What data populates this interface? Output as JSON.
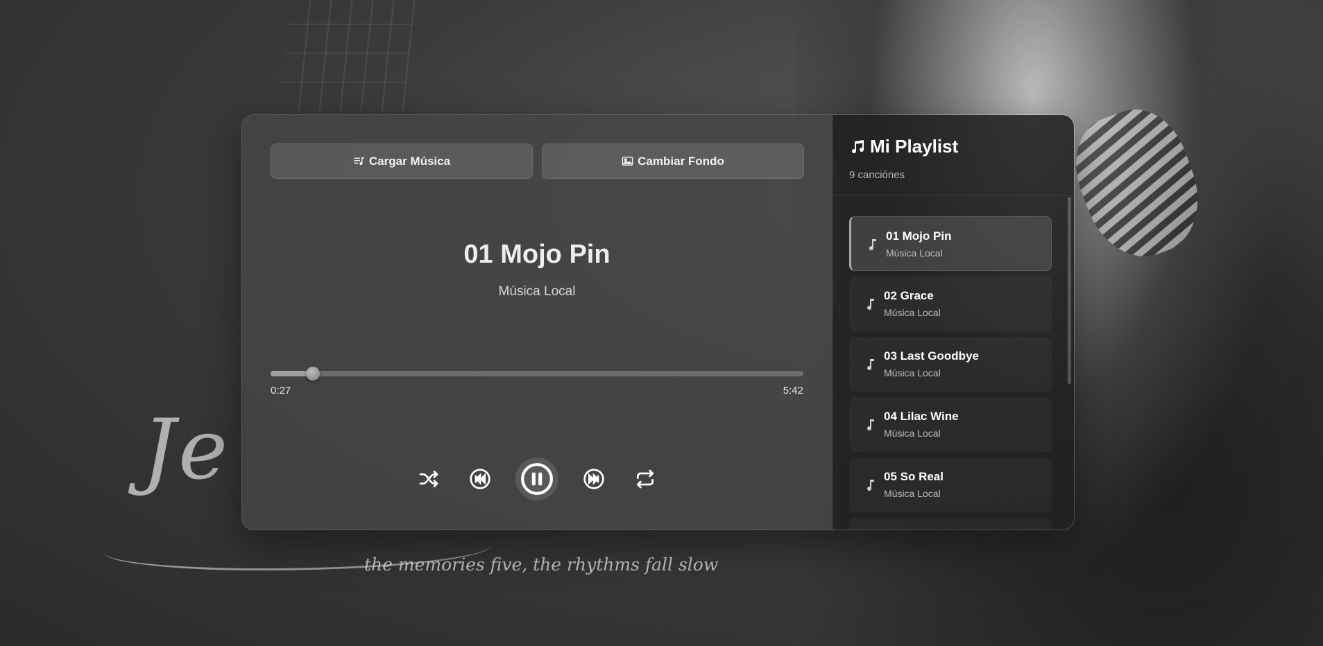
{
  "background": {
    "tagline": "the memories five, the rhythms fall slow",
    "script": "Je"
  },
  "toolbar": {
    "load_label": "Cargar Música",
    "background_label": "Cambiar Fondo"
  },
  "now_playing": {
    "title": "01 Mojo Pin",
    "artist": "Música Local",
    "current_time": "0:27",
    "total_time": "5:42",
    "progress": 0.079
  },
  "controls": {
    "shuffle_icon": "shuffle-icon",
    "prev_icon": "previous-track-icon",
    "play_icon": "pause-icon",
    "next_icon": "next-track-icon",
    "repeat_icon": "repeat-icon"
  },
  "playlist": {
    "title": "Mi Playlist",
    "count": "9 canciónes",
    "items": [
      {
        "title": "01 Mojo Pin",
        "artist": "Música Local"
      },
      {
        "title": "02 Grace",
        "artist": "Música Local"
      },
      {
        "title": "03 Last Goodbye",
        "artist": "Música Local"
      },
      {
        "title": "04 Lilac Wine",
        "artist": "Música Local"
      },
      {
        "title": "05 So Real",
        "artist": "Música Local"
      }
    ]
  },
  "colors": {
    "accent": "#ffffff",
    "panel": "#464646",
    "sidebar": "#202020"
  }
}
